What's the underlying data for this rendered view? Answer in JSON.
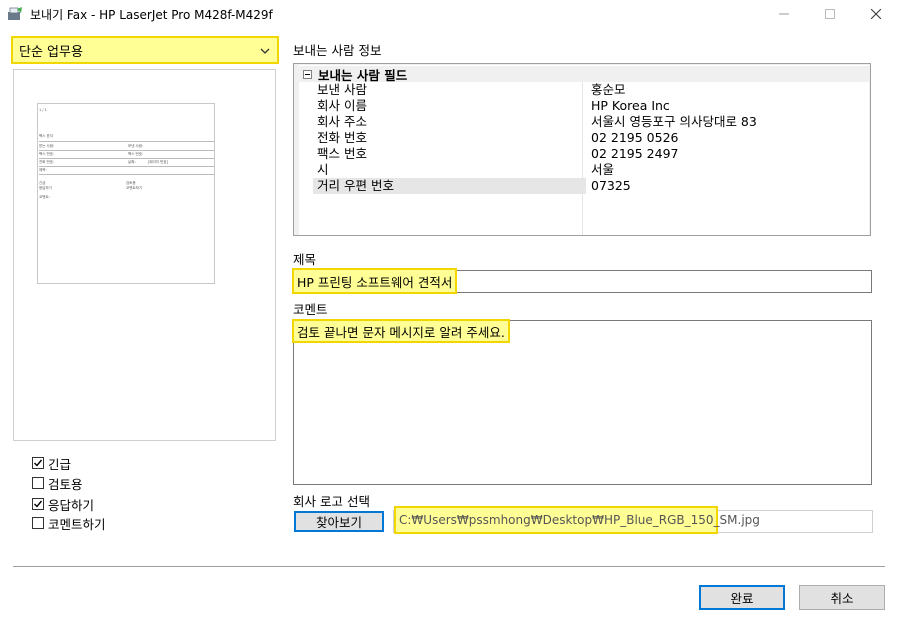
{
  "window": {
    "title": "보내기 Fax - HP LaserJet Pro M428f-M429f"
  },
  "template_select": {
    "value": "단순 업무용"
  },
  "preview": {
    "page_number": "1 / 1",
    "heading": "팩스 표지",
    "rows": [
      {
        "left": "받는 사람:",
        "right": "보낸 사람:"
      },
      {
        "left": "팩스 번호:",
        "right": "팩스 번호:"
      },
      {
        "left": "전화 번호:",
        "right": "날짜:",
        "extra": "[페이지 번호]"
      },
      {
        "left": "제목:",
        "right": ""
      }
    ],
    "checks_left": [
      "긴급",
      "응답하기"
    ],
    "checks_right": [
      "검토용",
      "코멘트하기"
    ],
    "comment_label": "코멘트:"
  },
  "options": {
    "urgent": {
      "label": "긴급",
      "checked": true
    },
    "review": {
      "label": "검토용",
      "checked": false
    },
    "reply": {
      "label": "응답하기",
      "checked": true
    },
    "comment": {
      "label": "코멘트하기",
      "checked": false
    }
  },
  "sender_info": {
    "section_label": "보내는 사람 정보",
    "category": "보내는 사람 필드",
    "fields": [
      {
        "name": "보낸 사람",
        "value": "홍순모"
      },
      {
        "name": "회사 이름",
        "value": "HP Korea Inc"
      },
      {
        "name": "회사 주소",
        "value": "서울시 영등포구 의사당대로 83"
      },
      {
        "name": "전화 번호",
        "value": "02 2195 0526"
      },
      {
        "name": "팩스 번호",
        "value": "02 2195 2497"
      },
      {
        "name": "시",
        "value": "서울"
      },
      {
        "name": "거리 우편 번호",
        "value": "07325"
      }
    ]
  },
  "subject": {
    "label": "제목",
    "value": "HP 프린팅 소프트웨어 견적서"
  },
  "comment": {
    "label": "코멘트",
    "value": "검토 끝나면 문자 메시지로 알려 주세요."
  },
  "logo": {
    "label": "회사 로고 선택",
    "browse_label": "찾아보기",
    "path": "C:₩Users₩pssmhong₩Desktop₩HP_Blue_RGB_150_SM.jpg"
  },
  "footer": {
    "ok_label": "완료",
    "cancel_label": "취소"
  },
  "colors": {
    "highlight_fill": "#ffff96",
    "highlight_border": "#f2d600",
    "accent": "#0078d7"
  }
}
